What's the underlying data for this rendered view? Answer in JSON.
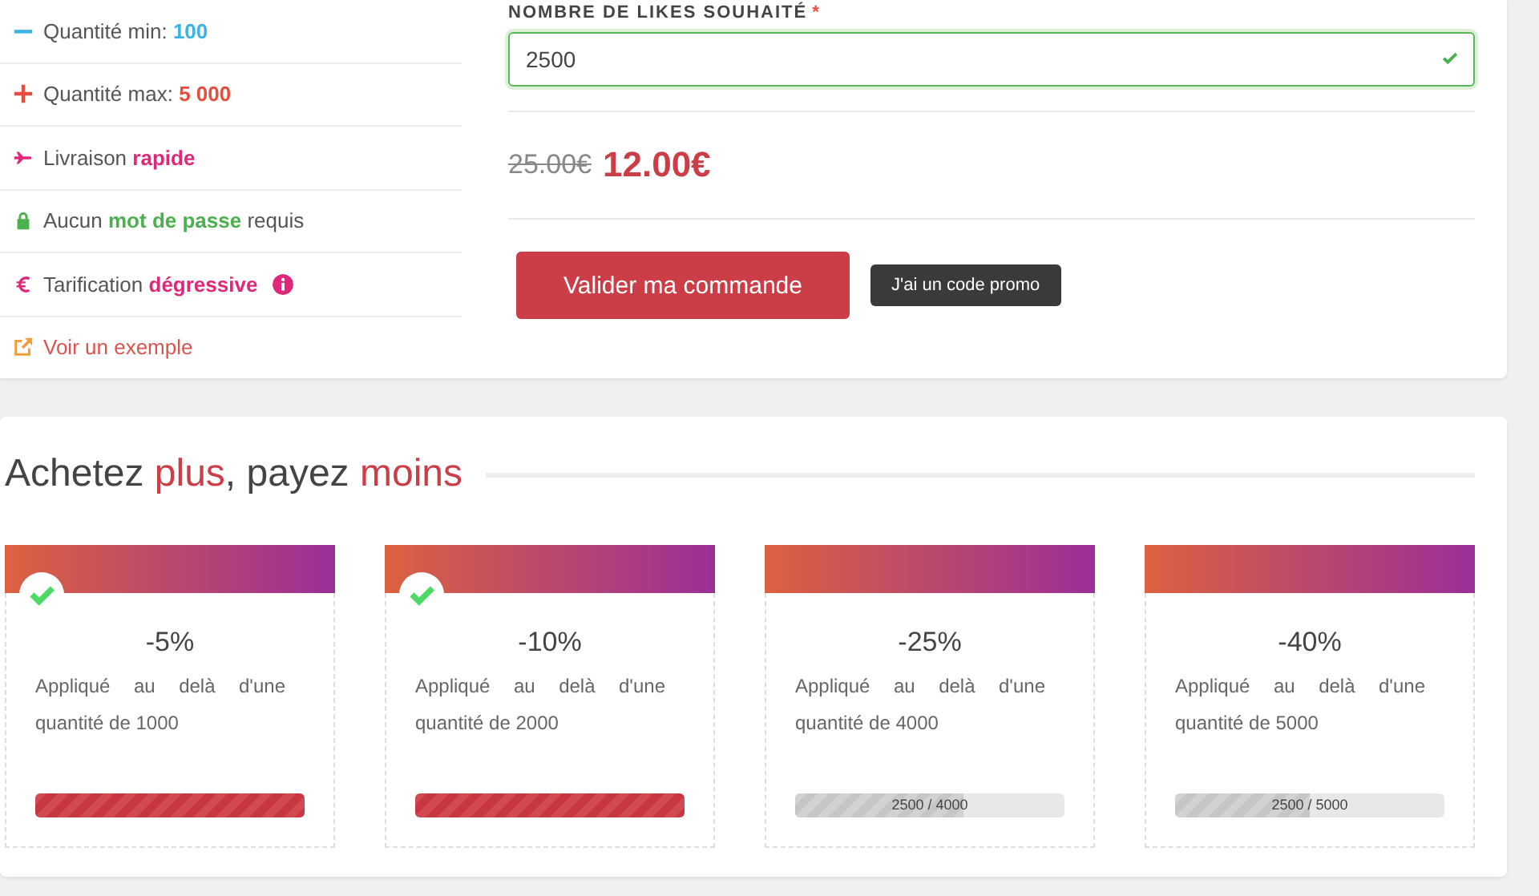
{
  "features": [
    {
      "kind": "minus",
      "before": "Quantité min:",
      "highlight": "100",
      "color": "#3bb4e5",
      "info": false
    },
    {
      "kind": "plus",
      "before": "Quantité max:",
      "highlight": "5 000",
      "color": "#e74c3c",
      "info": false
    },
    {
      "kind": "plane",
      "before": "Livraison",
      "highlight": "rapide",
      "color": "#e0287a",
      "info": false
    },
    {
      "kind": "lock",
      "before": "Aucun",
      "highlight": "mot de passe",
      "after": "requis",
      "color": "#4cb04f",
      "info": false
    },
    {
      "kind": "euro",
      "before": "Tarification",
      "highlight": "dégressive",
      "color": "#e0287a",
      "info": true
    },
    {
      "kind": "link",
      "before": "Voir un exemple",
      "color": "#f39c3c",
      "info": false
    }
  ],
  "order": {
    "label": "NOMBRE DE LIKES SOUHAITÉ",
    "required_mark": "*",
    "value": "2500",
    "valid": true,
    "old_price": "25.00€",
    "price": "12.00€",
    "submit": "Valider ma commande",
    "promo": "J'ai un code promo"
  },
  "discounts": {
    "title_parts": [
      {
        "text": "Achetez",
        "accent": false
      },
      {
        "text": "plus",
        "accent": true
      },
      {
        "text": ", payez",
        "accent": false
      },
      {
        "text": "moins",
        "accent": true
      }
    ],
    "tiers": [
      {
        "discount": "-5%",
        "description": "Appliqué au delà d'une quantité de 1000",
        "reached": true,
        "level": 1
      },
      {
        "discount": "-10%",
        "description": "Appliqué au delà d'une quantité de 2000",
        "reached": true,
        "level": 1
      },
      {
        "discount": "-25%",
        "description": "Appliqué au delà d'une quantité de 4000",
        "reached": false,
        "level": 0.625,
        "progress": "2500 / 4000"
      },
      {
        "discount": "-40%",
        "description": "Appliqué au delà d'une quantité de 5000",
        "reached": false,
        "level": 0.5,
        "progress": "2500 / 5000"
      }
    ]
  }
}
